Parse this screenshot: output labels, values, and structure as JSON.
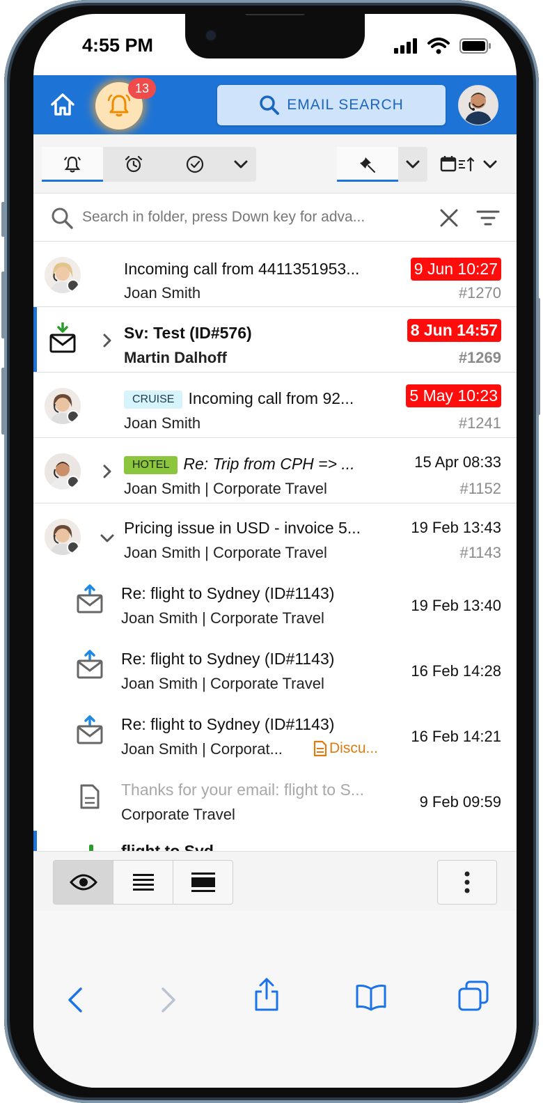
{
  "status": {
    "time": "4:55 PM"
  },
  "topbar": {
    "notification_count": "13",
    "email_search_label": "EMAIL SEARCH"
  },
  "search": {
    "placeholder": "Search in folder, press Down key for adva..."
  },
  "emails": [
    {
      "subject": "Incoming call from 4411351953...",
      "sender": "Joan Smith",
      "date": "9 Jun 10:27",
      "id": "#1270",
      "date_overdue": true
    },
    {
      "subject": "Sv: Test (ID#576)",
      "sender": "Martin Dalhoff",
      "date": "8 Jun 14:57",
      "id": "#1269",
      "date_overdue": true,
      "unread": true
    },
    {
      "tag": "CRUISE",
      "subject": "Incoming call from 92...",
      "sender": "Joan Smith",
      "date": "5 May 10:23",
      "id": "#1241",
      "date_overdue": true
    },
    {
      "tag": "HOTEL",
      "subject": "Re: Trip from CPH => ...",
      "sender": "Joan Smith | Corporate Travel",
      "date": "15 Apr 08:33",
      "id": "#1152"
    },
    {
      "subject": "Pricing issue in USD - invoice 5...",
      "sender": "Joan Smith | Corporate Travel",
      "date": "19 Feb 13:43",
      "id": "#1143"
    }
  ],
  "thread": [
    {
      "subject": "Re: flight to Sydney (ID#1143)",
      "sender": "Joan Smith | Corporate Travel",
      "date": "19 Feb 13:40"
    },
    {
      "subject": "Re: flight to Sydney (ID#1143)",
      "sender": "Joan Smith | Corporate Travel",
      "date": "16 Feb 14:28"
    },
    {
      "subject": "Re: flight to Sydney (ID#1143)",
      "sender": "Joan Smith | Corporat...",
      "attachment": "Discu...",
      "date": "16 Feb 14:21"
    },
    {
      "subject": "Thanks for your email: flight to S...",
      "sender": "Corporate Travel",
      "date": "9 Feb 09:59",
      "draft": true
    }
  ],
  "partial_row": {
    "subject": "flight to Syd"
  },
  "colors": {
    "accent": "#1e74d6",
    "overdue": "#ff0d0d",
    "cruise_tag": "#d7f3fb",
    "hotel_tag": "#8cc63f",
    "badge": "#ef4b4b"
  },
  "icons": [
    "home-icon",
    "bell-icon",
    "alarm-icon",
    "check-circle-icon",
    "pin-icon",
    "calendar-sort-icon",
    "search-icon",
    "clear-icon",
    "filter-icon",
    "eye-icon",
    "list-icon",
    "compact-list-icon",
    "more-icon"
  ]
}
